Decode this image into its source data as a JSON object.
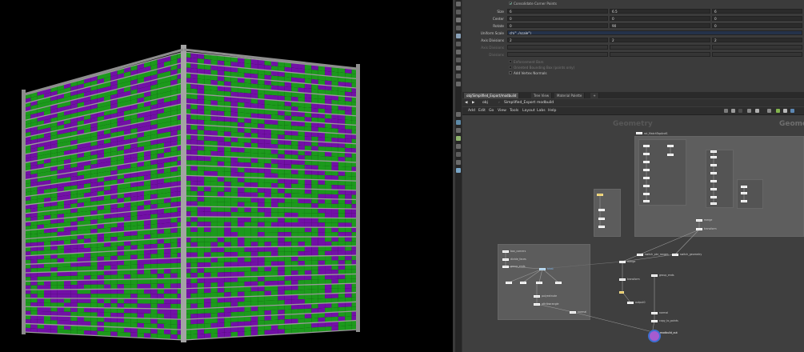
{
  "colors": {
    "panel_bg": "#3b3b3b",
    "network_bg": "#3f3f3f",
    "field_bg": "#2b2b2b",
    "expr_bg": "#24324a",
    "cube_green": "#1c9a1c",
    "cube_purple": "#7210a6",
    "cube_frame": "#8d8d8d",
    "node_white": "#d6d6d6",
    "node_yellow": "#e2c25c",
    "output_purple": "#a55bd0",
    "output_ring": "#3d6fd0"
  },
  "params": {
    "consolidate_label": "Consolidate Corner Points",
    "consolidate_checked": true,
    "size": {
      "label": "Size",
      "x": "6",
      "y": "6.5",
      "z": "6"
    },
    "center": {
      "label": "Center",
      "x": "0",
      "y": "0",
      "z": "0"
    },
    "rotate": {
      "label": "Rotate",
      "x": "0",
      "y": "90",
      "z": "0"
    },
    "uniform_scale": {
      "label": "Uniform Scale",
      "value": "ch(\"../scale\")"
    },
    "axis_divisions": {
      "label": "Axis Divisions",
      "x": "2",
      "y": "2",
      "z": "2"
    },
    "axis_divisions_disabled": {
      "label": "Axis Divisions",
      "x": "",
      "y": "",
      "z": ""
    },
    "divisions": {
      "label": "Divisions"
    },
    "enforcement_bars": "Enforcement Bars",
    "oriented_bbox": "Oriented Bounding Box (points only)",
    "add_vertex_normals": "Add Vertex Normals"
  },
  "tabs": [
    {
      "label": "obj/Simplified_Export/modbuild",
      "active": true
    },
    {
      "label": "Tree View",
      "active": false
    },
    {
      "label": "Material Palette",
      "active": false
    }
  ],
  "path": [
    "obj",
    "Simplified_Export",
    "modbuild"
  ],
  "menus": [
    "Add",
    "Edit",
    "Go",
    "View",
    "Tools",
    "Layout",
    "Labs",
    "Help"
  ],
  "network": {
    "watermark_left": "Geometry",
    "watermark_right": "Geome",
    "subnet_label": "rot_MatchTopAndS",
    "nodes": [
      {
        "label": "switch_pbr_ranges",
        "blue": false
      },
      {
        "label": "switch_geometry",
        "blue": false
      },
      {
        "label": "merge",
        "blue": false
      },
      {
        "label": "transform",
        "blue": false
      },
      {
        "label": "output0",
        "blue": false
      },
      {
        "label": "modbuild_out",
        "blue": false
      },
      {
        "label": "box_corners",
        "blue": false
      },
      {
        "label": "divide_faces",
        "blue": false
      },
      {
        "label": "group_ends",
        "blue": false
      },
      {
        "label": "copy_to_points",
        "blue": false
      },
      {
        "label": "polyextrude",
        "blue": false
      },
      {
        "label": "attribwrangle",
        "blue": false
      },
      {
        "label": "blast",
        "blue": true
      },
      {
        "label": "normal",
        "blue": false
      }
    ]
  }
}
